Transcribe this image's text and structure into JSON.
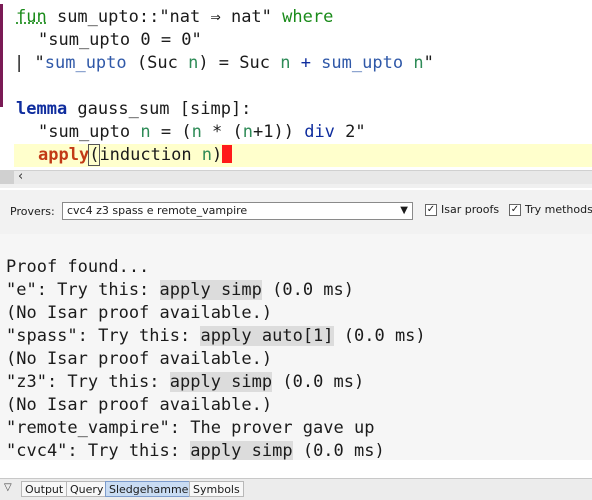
{
  "editor": {
    "lines": {
      "l1": {
        "kw_fun": "fun",
        "a": " sum_upto::",
        "b": "\"nat ⇒ nat\"",
        "kw_where": " where"
      },
      "l2": {
        "a": "\"sum_upto 0 = 0\""
      },
      "l3": {
        "bar": "|",
        "a": "\"",
        "fn1": "sum_upto",
        "b": " (Suc ",
        "n1": "n",
        "c": ") = Suc ",
        "n2": "n",
        "plus": " + ",
        "fn2": "sum_upto",
        "d": " ",
        "n3": "n",
        "e": "\""
      },
      "l5": {
        "kw_lemma": "lemma",
        "a": " gauss_sum [simp]:"
      },
      "l6": {
        "a": "\"sum_upto ",
        "n1": "n",
        "b": " = (",
        "n2": "n",
        "c": " * (",
        "n3": "n",
        "d": "+1)) ",
        "div": "div",
        "e": " 2\""
      },
      "l7": {
        "kw_apply": "apply",
        "paren": "(",
        "a": "induction ",
        "n1": "n",
        "b": ")"
      }
    }
  },
  "provers_bar": {
    "label": "Provers:",
    "value": "cvc4 z3 spass e remote_vampire",
    "isar_label": "Isar proofs",
    "methods_label": "Try methods"
  },
  "output": {
    "lines": [
      {
        "pre": "Proof found...",
        "hl": "",
        "post": ""
      },
      {
        "pre": "\"e\": Try this: ",
        "hl": "apply simp",
        "post": " (0.0 ms)"
      },
      {
        "pre": "(No Isar proof available.)",
        "hl": "",
        "post": ""
      },
      {
        "pre": "\"spass\": Try this: ",
        "hl": "apply auto[1]",
        "post": " (0.0 ms)"
      },
      {
        "pre": "(No Isar proof available.)",
        "hl": "",
        "post": ""
      },
      {
        "pre": "\"z3\": Try this: ",
        "hl": "apply simp",
        "post": " (0.0 ms)"
      },
      {
        "pre": "(No Isar proof available.)",
        "hl": "",
        "post": ""
      },
      {
        "pre": "\"remote_vampire\": The prover gave up",
        "hl": "",
        "post": ""
      },
      {
        "pre": "\"cvc4\": Try this: ",
        "hl": "apply simp",
        "post": " (0.0 ms)"
      }
    ]
  },
  "tabs": [
    "Output",
    "Query",
    "Sledgehammer",
    "Symbols"
  ],
  "active_tab": "Sledgehammer",
  "colors": {
    "keyword": "#1a8b1a",
    "apply": "#c23a15",
    "variable": "#2e8b57",
    "function": "#2f58a8",
    "tab_active": "#c9dcf3"
  }
}
